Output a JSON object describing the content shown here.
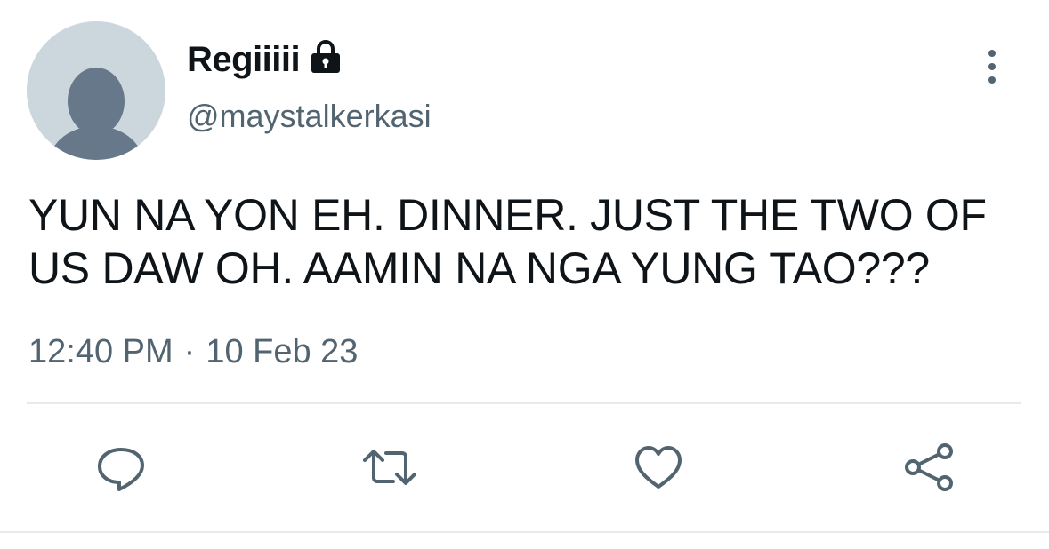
{
  "user": {
    "display_name": "Regiiiii",
    "handle": "@maystalkerkasi",
    "protected_icon": "lock-icon"
  },
  "tweet": {
    "text": "YUN NA YON EH. DINNER. JUST THE TWO OF US DAW OH. AAMIN NA NGA YUNG TAO???",
    "time": "12:40 PM",
    "separator": "·",
    "date": "10 Feb 23"
  },
  "actions": [
    {
      "icon": "reply-icon"
    },
    {
      "icon": "retweet-icon"
    },
    {
      "icon": "like-icon"
    },
    {
      "icon": "share-icon"
    }
  ],
  "colors": {
    "text_primary": "#0f1419",
    "text_secondary": "#536471",
    "avatar_bg": "#ccd6dd",
    "avatar_fg": "#66788a",
    "divider": "#e7ebee"
  }
}
